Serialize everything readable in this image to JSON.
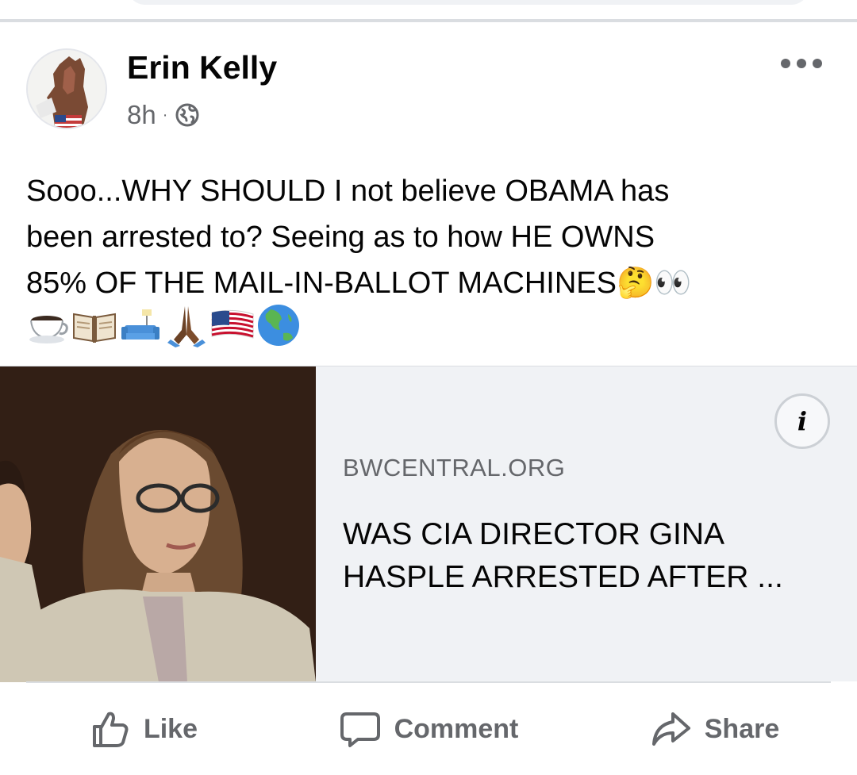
{
  "post": {
    "author": "Erin Kelly",
    "time": "8h",
    "separator": "·",
    "text_lines": [
      "Sooo...WHY SHOULD I not believe OBAMA has",
      "been arrested to? Seeing as to how HE OWNS",
      "85% OF THE MAIL-IN-BALLOT MACHINES🤔👀"
    ],
    "emoji_line": [
      "☕",
      "📖",
      "🛋️",
      "🙏🏾",
      "🇺🇸",
      "🌏"
    ]
  },
  "link": {
    "domain": "BWCENTRAL.ORG",
    "headline": "WAS CIA DIRECTOR GINA HASPLE ARRESTED AFTER ...",
    "info_icon": "i"
  },
  "actions": {
    "like": "Like",
    "comment": "Comment",
    "share": "Share"
  },
  "icons": {
    "more": "more-options-icon",
    "privacy": "globe-icon",
    "info": "info-icon"
  },
  "colors": {
    "text": "#050505",
    "secondary": "#65676b",
    "card_bg": "#f0f2f5",
    "divider": "#dadde1"
  }
}
